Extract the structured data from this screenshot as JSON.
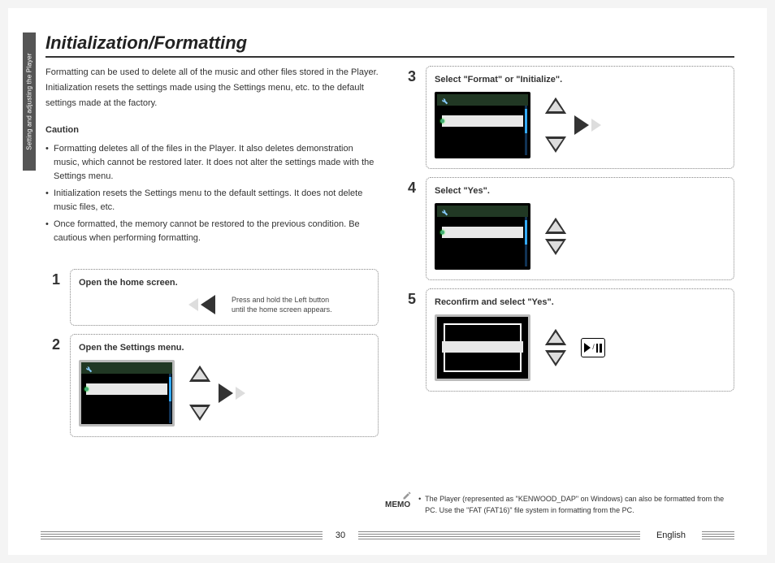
{
  "sideTab": "Setting and adjusting the Player",
  "title": "Initialization/Formatting",
  "intro": [
    "Formatting can be used to delete all of the music and other files stored in the Player.",
    "Initialization resets the settings made using the Settings menu, etc. to the default",
    "settings made at the factory."
  ],
  "cautionHeading": "Caution",
  "cautions": [
    "Formatting deletes all of the files in the Player. It also deletes demonstration music, which cannot be restored later. It does not alter the settings made with the Settings menu.",
    "Initialization resets the Settings menu to the default settings. It does not delete music files, etc.",
    "Once formatted, the memory cannot be restored to the previous condition. Be cautious when performing formatting."
  ],
  "steps": {
    "s1": {
      "num": "1",
      "title": "Open the home screen.",
      "hint1": "Press and hold the Left button",
      "hint2": "until the home screen appears."
    },
    "s2": {
      "num": "2",
      "title": "Open the Settings menu."
    },
    "s3": {
      "num": "3",
      "title": "Select \"Format\" or \"Initialize\"."
    },
    "s4": {
      "num": "4",
      "title": "Select \"Yes\"."
    },
    "s5": {
      "num": "5",
      "title": "Reconfirm and select \"Yes\"."
    }
  },
  "memoLabel": "MEMO",
  "memo": [
    "The Player (represented as \"KENWOOD_DAP\" on Windows) can also be formatted from the PC. Use the \"FAT (FAT16)\" file system in formatting from the PC."
  ],
  "pageNumber": "30",
  "language": "English"
}
